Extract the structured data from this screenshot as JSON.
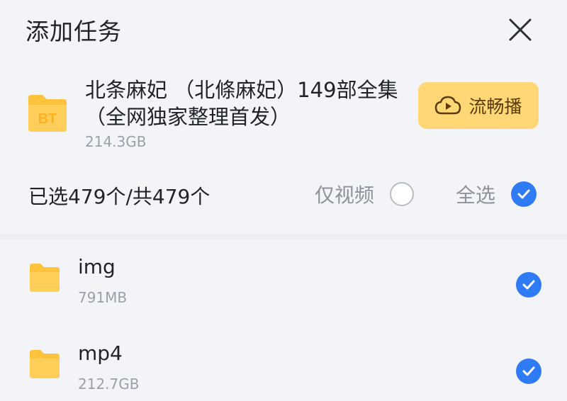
{
  "header": {
    "title": "添加任务"
  },
  "task": {
    "name": "北条麻妃 （北條麻妃）149部全集（全网独家整理首发）",
    "size": "214.3GB",
    "type_badge": "BT",
    "stream_label": "流畅播"
  },
  "selection": {
    "count_text": "已选479个/共479个",
    "video_only_label": "仅视频",
    "video_only_checked": false,
    "select_all_label": "全选",
    "select_all_checked": true
  },
  "files": [
    {
      "name": "img",
      "size": "791MB",
      "checked": true
    },
    {
      "name": "mp4",
      "size": "212.7GB",
      "checked": true
    }
  ],
  "colors": {
    "accent_blue": "#2f7bf5",
    "stream_button": "#ffd875",
    "folder": "#ffc23d",
    "background": "#f3f4f8"
  }
}
